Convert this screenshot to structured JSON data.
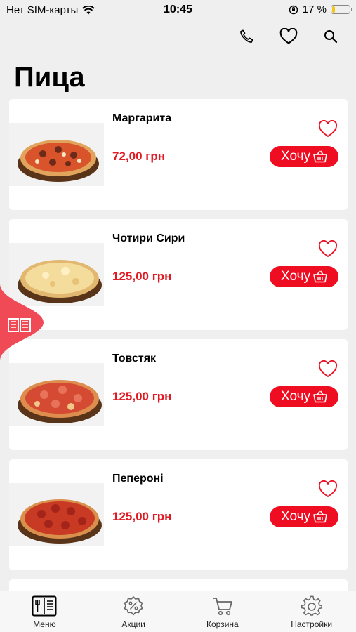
{
  "status_bar": {
    "carrier": "Нет SIM-карты",
    "time": "10:45",
    "battery_percent": "17 %",
    "battery_level": 0.17,
    "battery_color": "#f5c518"
  },
  "top_icons": [
    "phone-icon",
    "heart-icon",
    "search-icon"
  ],
  "page": {
    "title": "Пица"
  },
  "accent_color": "#ef0d22",
  "products": [
    {
      "name": "Маргарита",
      "price": "72,00 грн",
      "button": "Хочу",
      "image": "pizza-margarita"
    },
    {
      "name": "Чотири Сири",
      "price": "125,00 грн",
      "button": "Хочу",
      "image": "pizza-four-cheese"
    },
    {
      "name": "Товстяк",
      "price": "125,00 грн",
      "button": "Хочу",
      "image": "pizza-tovstiak"
    },
    {
      "name": "Пепероні",
      "price": "125,00 грн",
      "button": "Хочу",
      "image": "pizza-pepperoni"
    }
  ],
  "side_tab_icon": "menu-book-icon",
  "tab_bar": [
    {
      "label": "Меню",
      "icon": "menu-icon"
    },
    {
      "label": "Акции",
      "icon": "discount-icon"
    },
    {
      "label": "Корзина",
      "icon": "cart-icon"
    },
    {
      "label": "Настройки",
      "icon": "settings-icon"
    }
  ]
}
